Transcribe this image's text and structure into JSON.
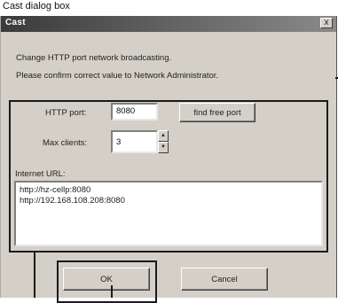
{
  "caption": "Cast dialog box",
  "dialog": {
    "title": "Cast",
    "close_glyph": "x",
    "intro_line1": "Change HTTP port network broadcasting.",
    "intro_line2": "Please confirm correct value to Network Administrator.",
    "http_port": {
      "label": "HTTP port:",
      "value": "8080"
    },
    "find_free_port_label": "find free port",
    "max_clients": {
      "label": "Max clients:",
      "value": "3"
    },
    "internet_url": {
      "label": "Internet URL:",
      "lines": [
        "http://hz-cellp:8080",
        "http://192.168.108.208:8080"
      ]
    },
    "ok_label": "OK",
    "cancel_label": "Cancel"
  }
}
